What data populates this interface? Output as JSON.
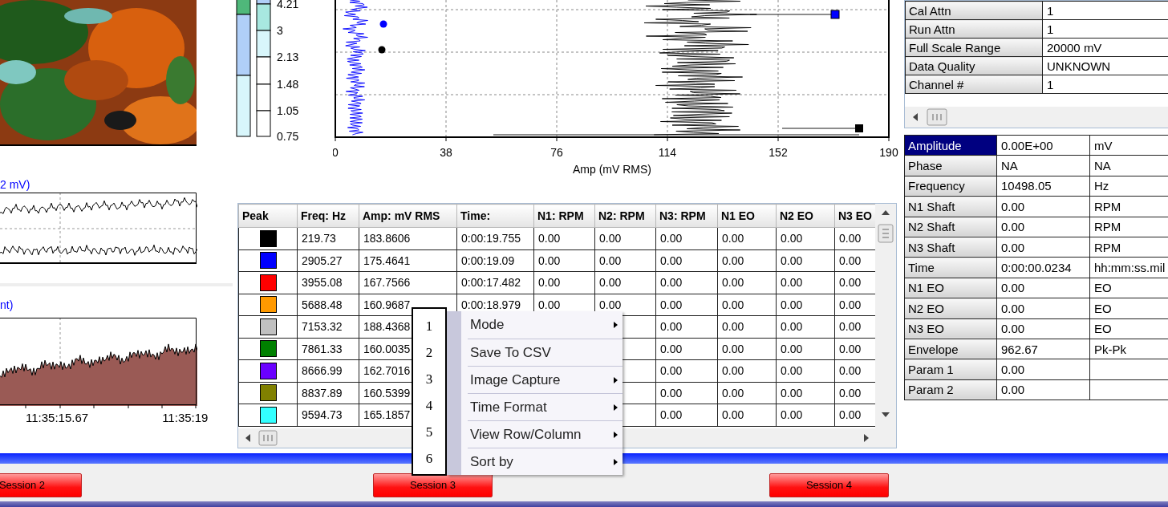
{
  "color_scale": {
    "labels": [
      "4.21",
      "3",
      "2.13",
      "1.48",
      "1.05",
      "0.75"
    ]
  },
  "spectrum_chart": {
    "x_ticks": [
      "0",
      "38",
      "76",
      "114",
      "152",
      "190"
    ],
    "x_title": "Amp (mV RMS)"
  },
  "trend_chart": {
    "title": "2 mV)"
  },
  "history_chart": {
    "title": "nt)",
    "x_labels": [
      "11:35:15.67",
      "11:35:19"
    ]
  },
  "peak_table": {
    "columns": [
      "Peak",
      "Freq: Hz",
      "Amp: mV RMS",
      "Time:",
      "N1: RPM",
      "N2: RPM",
      "N3: RPM",
      "N1 EO",
      "N2 EO",
      "N3 EO"
    ],
    "rows": [
      {
        "color": "#000000",
        "freq": "219.73",
        "amp": "183.8606",
        "time": "0:00:19.755",
        "n1_rpm": "0.00",
        "n2_rpm": "0.00",
        "n3_rpm": "0.00",
        "n1_eo": "0.00",
        "n2_eo": "0.00",
        "n3_eo": "0.00"
      },
      {
        "color": "#0000ff",
        "freq": "2905.27",
        "amp": "175.4641",
        "time": "0:00:19.09",
        "n1_rpm": "0.00",
        "n2_rpm": "0.00",
        "n3_rpm": "0.00",
        "n1_eo": "0.00",
        "n2_eo": "0.00",
        "n3_eo": "0.00"
      },
      {
        "color": "#ff0000",
        "freq": "3955.08",
        "amp": "167.7566",
        "time": "0:00:17.482",
        "n1_rpm": "0.00",
        "n2_rpm": "0.00",
        "n3_rpm": "0.00",
        "n1_eo": "0.00",
        "n2_eo": "0.00",
        "n3_eo": "0.00"
      },
      {
        "color": "#ff9900",
        "freq": "5688.48",
        "amp": "160.9687",
        "time": "0:00:18.979",
        "n1_rpm": "0.00",
        "n2_rpm": "0.00",
        "n3_rpm": "0.00",
        "n1_eo": "0.00",
        "n2_eo": "0.00",
        "n3_eo": "0.00"
      },
      {
        "color": "#c0c0c0",
        "freq": "7153.32",
        "amp": "188.4368",
        "n3_rpm": "0.00",
        "n1_eo": "0.00",
        "n2_eo": "0.00",
        "n3_eo": "0.00"
      },
      {
        "color": "#008000",
        "freq": "7861.33",
        "amp": "160.0035",
        "n3_rpm": "0.00",
        "n1_eo": "0.00",
        "n2_eo": "0.00",
        "n3_eo": "0.00"
      },
      {
        "color": "#6a00ff",
        "freq": "8666.99",
        "amp": "162.7016",
        "n3_rpm": "0.00",
        "n1_eo": "0.00",
        "n2_eo": "0.00",
        "n3_eo": "0.00"
      },
      {
        "color": "#808000",
        "freq": "8837.89",
        "amp": "160.5399",
        "n3_rpm": "0.00",
        "n1_eo": "0.00",
        "n2_eo": "0.00",
        "n3_eo": "0.00"
      },
      {
        "color": "#33ffff",
        "freq": "9594.73",
        "amp": "165.1857",
        "n3_rpm": "0.00",
        "n1_eo": "0.00",
        "n2_eo": "0.00",
        "n3_eo": "0.00"
      }
    ]
  },
  "settings_grid": [
    {
      "label": "Cal Attn",
      "value": "1"
    },
    {
      "label": "Run Attn",
      "value": "1"
    },
    {
      "label": "Full Scale Range",
      "value": "20000 mV"
    },
    {
      "label": "Data Quality",
      "value": "UNKNOWN"
    },
    {
      "label": "Channel #",
      "value": "1"
    }
  ],
  "readout_grid": [
    {
      "label": "Amplitude",
      "value": "0.00E+00",
      "unit": "mV",
      "selected": true
    },
    {
      "label": "Phase",
      "value": "NA",
      "unit": "NA",
      "selected": false
    },
    {
      "label": "Frequency",
      "value": "10498.05",
      "unit": "Hz",
      "selected": false
    },
    {
      "label": "N1 Shaft",
      "value": "0.00",
      "unit": "RPM",
      "selected": false
    },
    {
      "label": "N2 Shaft",
      "value": "0.00",
      "unit": "RPM",
      "selected": false
    },
    {
      "label": "N3 Shaft",
      "value": "0.00",
      "unit": "RPM",
      "selected": false
    },
    {
      "label": "Time",
      "value": "0:00:00.0234",
      "unit": "hh:mm:ss.mil",
      "selected": false
    },
    {
      "label": "N1 EO",
      "value": "0.00",
      "unit": "EO",
      "selected": false
    },
    {
      "label": "N2 EO",
      "value": "0.00",
      "unit": "EO",
      "selected": false
    },
    {
      "label": "N3 EO",
      "value": "0.00",
      "unit": "EO",
      "selected": false
    },
    {
      "label": "Envelope",
      "value": "962.67",
      "unit": "Pk-Pk",
      "selected": false
    },
    {
      "label": "Param 1",
      "value": "0.00",
      "selected": false
    },
    {
      "label": "Param 2",
      "value": "0.00",
      "selected": false
    }
  ],
  "annotation_numbers": [
    "1",
    "2",
    "3",
    "4",
    "5",
    "6"
  ],
  "context_menu": [
    {
      "label": "Mode",
      "has_submenu": true
    },
    {
      "label": "Save To CSV",
      "has_submenu": false
    },
    {
      "label": "Image Capture",
      "has_submenu": true
    },
    {
      "label": "Time Format",
      "has_submenu": true
    },
    {
      "label": "View Row/Column",
      "has_submenu": true
    },
    {
      "label": "Sort by",
      "has_submenu": true
    }
  ],
  "sessions": [
    "Session 2",
    "Session 3",
    "Session 4"
  ]
}
